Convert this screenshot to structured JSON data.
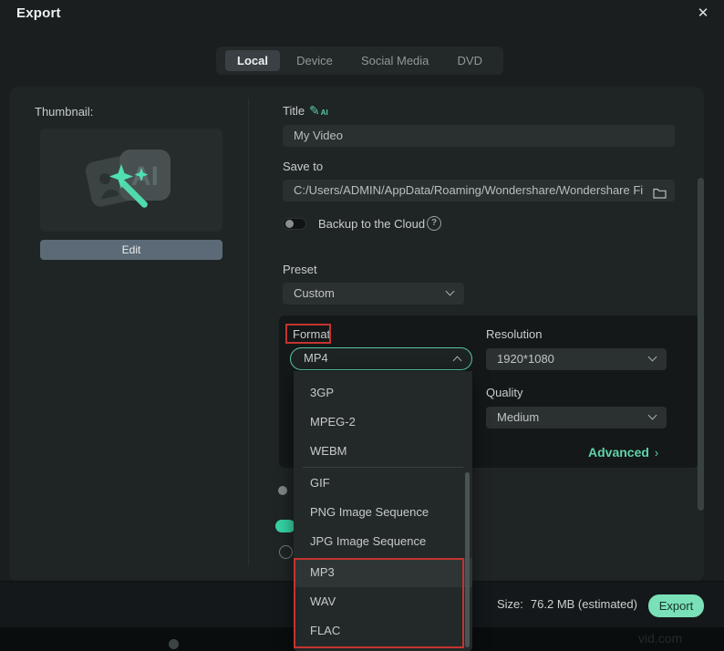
{
  "window": {
    "title": "Export",
    "close_icon": "✕"
  },
  "tabs": [
    {
      "label": "Local",
      "active": true
    },
    {
      "label": "Device",
      "active": false
    },
    {
      "label": "Social Media",
      "active": false
    },
    {
      "label": "DVD",
      "active": false
    }
  ],
  "thumbnail": {
    "label": "Thumbnail:",
    "placeholder_text": "AI",
    "edit_button": "Edit"
  },
  "fields": {
    "title_label": "Title",
    "title_ai_icon": "AI",
    "title_value": "My Video",
    "save_to_label": "Save to",
    "save_to_value": "C:/Users/ADMIN/AppData/Roaming/Wondershare/Wondershare Fi",
    "backup_label": "Backup to the Cloud",
    "help_glyph": "?",
    "preset_label": "Preset",
    "preset_value": "Custom"
  },
  "format_section": {
    "format_label": "Format",
    "format_value": "MP4",
    "resolution_label": "Resolution",
    "resolution_value": "1920*1080",
    "quality_label": "Quality",
    "quality_value": "Medium",
    "advanced_label": "Advanced",
    "advanced_arrow": "›"
  },
  "format_dropdown": {
    "group1": [
      "3GP",
      "MPEG-2",
      "WEBM"
    ],
    "group2": [
      "GIF",
      "PNG Image Sequence",
      "JPG Image Sequence"
    ],
    "group3": [
      "MP3",
      "WAV",
      "FLAC"
    ],
    "highlighted_item": "MP3"
  },
  "footer": {
    "size_label": "Size:",
    "size_value": "76.2 MB (estimated)",
    "export_button": "Export"
  },
  "watermark": "vid.com",
  "colors": {
    "accent_button": "#7AE0B8",
    "teal_border": "#58C7A4",
    "annotation_red": "#C3342F",
    "toggle_on": "#36D1A3",
    "panel_bg": "#1F2424",
    "dialog_bg": "#1A1E1E"
  }
}
